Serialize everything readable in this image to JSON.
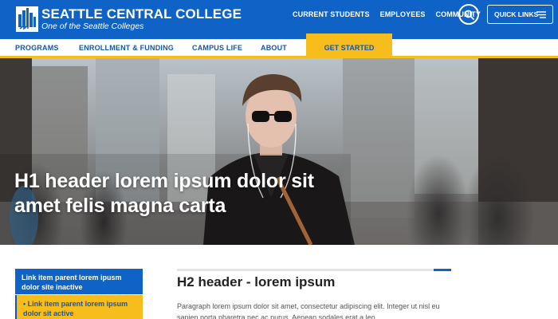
{
  "header": {
    "title": "SEATTLE CENTRAL COLLEGE",
    "subtitle": "One of the Seattle Colleges",
    "links": [
      "CURRENT STUDENTS",
      "EMPLOYEES",
      "COMMUNITY"
    ],
    "quick_links_label": "QUICK LINKS"
  },
  "nav": {
    "items": [
      "PROGRAMS",
      "ENROLLMENT & FUNDING",
      "CAMPUS LIFE",
      "ABOUT"
    ],
    "cta": "GET STARTED"
  },
  "hero": {
    "title": "H1 header lorem ipsum dolor sit amet felis magna carta"
  },
  "sidebar": {
    "items": [
      {
        "label": "Link item parent lorem ipusm dolor site inactive"
      },
      {
        "label": "• Link item parent lorem ipsum dolor sit active"
      }
    ]
  },
  "main": {
    "heading": "H2 header - lorem ipsum",
    "paragraph": "Paragraph lorem ipsum dolor sit amet, consectetur adipiscing elit. Integer ut nisl eu sapien porta pharetra nec ac purus. Aenean sodales erat a leo"
  },
  "colors": {
    "brand_blue": "#0f63c6",
    "accent_gold": "#f7bd1d",
    "nav_text_blue": "#0f57b0"
  }
}
